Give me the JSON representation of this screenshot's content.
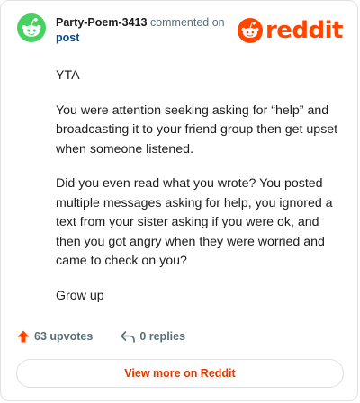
{
  "header": {
    "author": "Party-Poem-3413",
    "action_text": "commented on",
    "post_link": "post",
    "logo_text": "reddit"
  },
  "comment": {
    "paragraphs": [
      "YTA",
      "You were attention seeking asking for “help” and broadcasting it to your friend group then get upset when someone listened.",
      "Did you even read what you wrote? You posted multiple messages asking for help, you ignored a text from your sister asking if you were ok, and then you got angry when they were worried and came to check on you?",
      "Grow up"
    ]
  },
  "actions": {
    "upvotes": "63 upvotes",
    "replies": "0 replies"
  },
  "footer": {
    "view_more": "View more on Reddit"
  },
  "colors": {
    "brand": "#ff4500",
    "avatar_bg": "#46d160",
    "link": "#0a4a8c",
    "muted": "#576f76"
  },
  "icons": [
    "snoo-avatar-icon",
    "reddit-logo-icon",
    "upvote-icon",
    "reply-icon"
  ]
}
